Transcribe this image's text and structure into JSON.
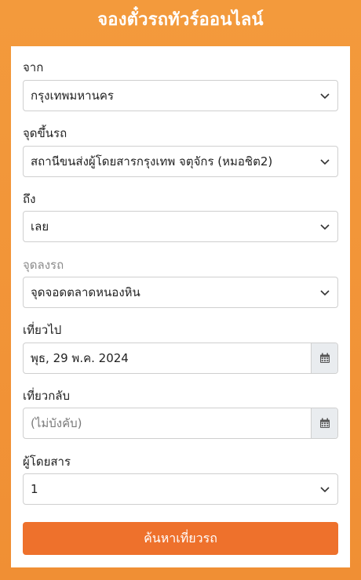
{
  "header": {
    "title": "จองตั๋วรถทัวร์ออนไลน์"
  },
  "form": {
    "from": {
      "label": "จาก",
      "value": "กรุงเทพมหานคร"
    },
    "boarding": {
      "label": "จุดขึ้นรถ",
      "value": "สถานีขนส่งผู้โดยสารกรุงเทพ จตุจักร (หมอชิต2)"
    },
    "to": {
      "label": "ถึง",
      "value": "เลย"
    },
    "dropoff": {
      "label": "จุดลงรถ",
      "value": "จุดจอดตลาดหนองหิน"
    },
    "depart": {
      "label": "เที่ยวไป",
      "value": "พุธ, 29 พ.ค. 2024"
    },
    "return": {
      "label": "เที่ยวกลับ",
      "placeholder": "(ไม่บังคับ)"
    },
    "passengers": {
      "label": "ผู้โดยสาร",
      "value": "1"
    },
    "search_label": "ค้นหาเที่ยวรถ"
  },
  "colors": {
    "background": "#f39a3c",
    "accent_button": "#ee712c",
    "muted_label": "#8b8b8b"
  },
  "icons": {
    "dropdown": "chevron-down-icon",
    "calendar": "calendar-icon"
  }
}
